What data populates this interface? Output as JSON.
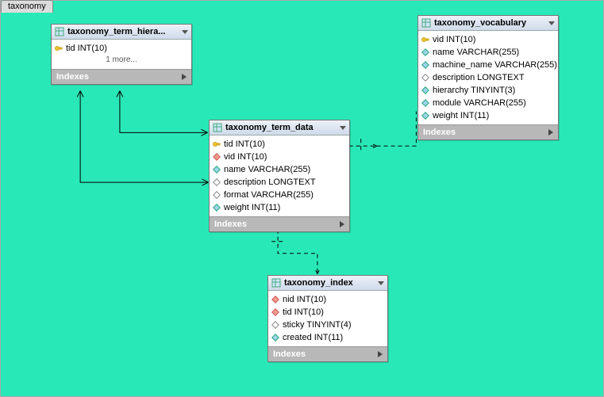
{
  "schema_tab": "taxonomy",
  "indexes_label": "Indexes",
  "more_label": "1 more...",
  "tables": {
    "hierarchy": {
      "title": "taxonomy_term_hiera...",
      "columns": [
        {
          "text": "tid INT(10)",
          "kind": "pk"
        }
      ]
    },
    "term_data": {
      "title": "taxonomy_term_data",
      "columns": [
        {
          "text": "tid INT(10)",
          "kind": "pk"
        },
        {
          "text": "vid INT(10)",
          "kind": "fk"
        },
        {
          "text": "name VARCHAR(255)",
          "kind": "attr"
        },
        {
          "text": "description LONGTEXT",
          "kind": "opt"
        },
        {
          "text": "format VARCHAR(255)",
          "kind": "opt"
        },
        {
          "text": "weight INT(11)",
          "kind": "attr"
        }
      ]
    },
    "vocabulary": {
      "title": "taxonomy_vocabulary",
      "columns": [
        {
          "text": "vid INT(10)",
          "kind": "pk"
        },
        {
          "text": "name VARCHAR(255)",
          "kind": "attr"
        },
        {
          "text": "machine_name VARCHAR(255)",
          "kind": "attr"
        },
        {
          "text": "description LONGTEXT",
          "kind": "opt"
        },
        {
          "text": "hierarchy TINYINT(3)",
          "kind": "attr"
        },
        {
          "text": "module VARCHAR(255)",
          "kind": "attr"
        },
        {
          "text": "weight INT(11)",
          "kind": "attr"
        }
      ]
    },
    "index": {
      "title": "taxonomy_index",
      "columns": [
        {
          "text": "nid INT(10)",
          "kind": "fk"
        },
        {
          "text": "tid INT(10)",
          "kind": "fk"
        },
        {
          "text": "sticky TINYINT(4)",
          "kind": "opt"
        },
        {
          "text": "created INT(11)",
          "kind": "attr"
        }
      ]
    }
  }
}
